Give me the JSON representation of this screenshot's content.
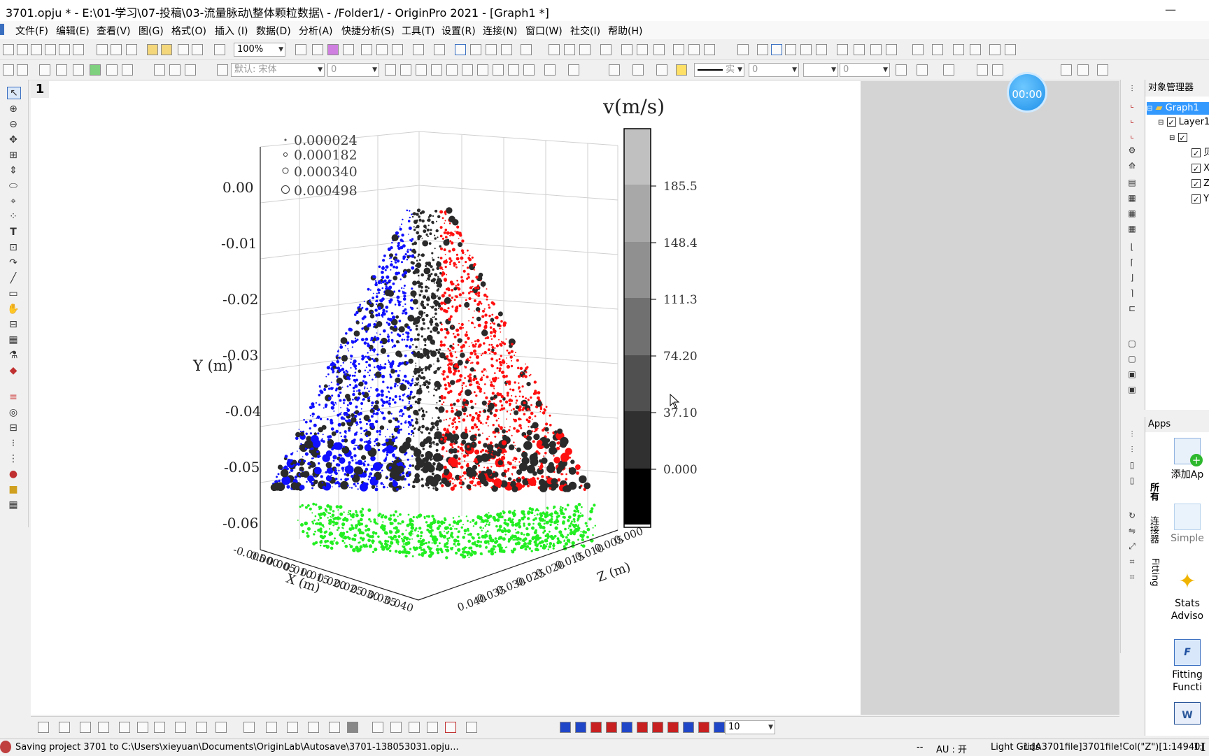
{
  "window": {
    "title": "3701.opju * - E:\\01-学习\\07-投稿\\03-流量脉动\\整体颗粒数据\\ - /Folder1/ - OriginPro 2021 - [Graph1 *]",
    "minimize": "—",
    "maximize": "□"
  },
  "menu": [
    "文件(F)",
    "编辑(E)",
    "查看(V)",
    "图(G)",
    "格式(O)",
    "插入 (I)",
    "数据(D)",
    "分析(A)",
    "快捷分析(S)",
    "工具(T)",
    "设置(R)",
    "连接(N)",
    "窗口(W)",
    "社交(I)",
    "帮助(H)"
  ],
  "toolbar": {
    "zoom": "100%",
    "font": "默认: 宋体",
    "font_size": "0",
    "line_style": "实",
    "line_width": "0",
    "fill_value": "0",
    "bottom_value": "10"
  },
  "graph": {
    "page_number": "1",
    "colorbar_title": "v(m/s)",
    "colorbar_ticks": [
      "185.5",
      "148.4",
      "111.3",
      "74.20",
      "37.10",
      "0.000"
    ],
    "size_legend": [
      "0.000024",
      "0.000182",
      "0.000340",
      "0.000498"
    ],
    "y_title": "Y (m)",
    "y_ticks": [
      "0.00",
      "-0.01",
      "-0.02",
      "-0.03",
      "-0.04",
      "-0.05",
      "-0.06"
    ],
    "x_title": "X (m)",
    "x_ticks": [
      "-0.005",
      "0.000",
      "0.005",
      "0.010",
      "0.015",
      "0.020",
      "0.025",
      "0.030",
      "0.035",
      "0.040"
    ],
    "z_title": "Z (m)",
    "z_ticks": [
      "0.000",
      "0.005",
      "0.010",
      "0.015",
      "0.020",
      "0.025",
      "0.030",
      "0.035",
      "0.040"
    ]
  },
  "timer": "00:00",
  "object_manager": {
    "title": "对象管理器",
    "graph": "Graph1",
    "layer": "Layer1",
    "items": [
      "贝",
      "X",
      "Z",
      "Y"
    ]
  },
  "apps": {
    "title": "Apps",
    "items": [
      "添加Ap",
      "Simple",
      "Stats Adviso",
      "Fitting Functi"
    ],
    "tabs": [
      "所有",
      "连接器",
      "Fitting"
    ]
  },
  "status": {
    "message": "Saving project 3701 to C:\\Users\\xieyuan\\Documents\\OriginLab\\Autosave\\3701-138053031.opju...",
    "dashes": "--",
    "au": "AU : 开",
    "grids": "Light Grids",
    "cell": "1:[A3701file]3701file!Col(\"Z\")[1:14940]",
    "extra": "1:["
  },
  "colors": {
    "blue_series": "#1010ff",
    "red_series": "#ff1010",
    "dark_series": "#2a2a2a",
    "green_series": "#22ee22"
  }
}
